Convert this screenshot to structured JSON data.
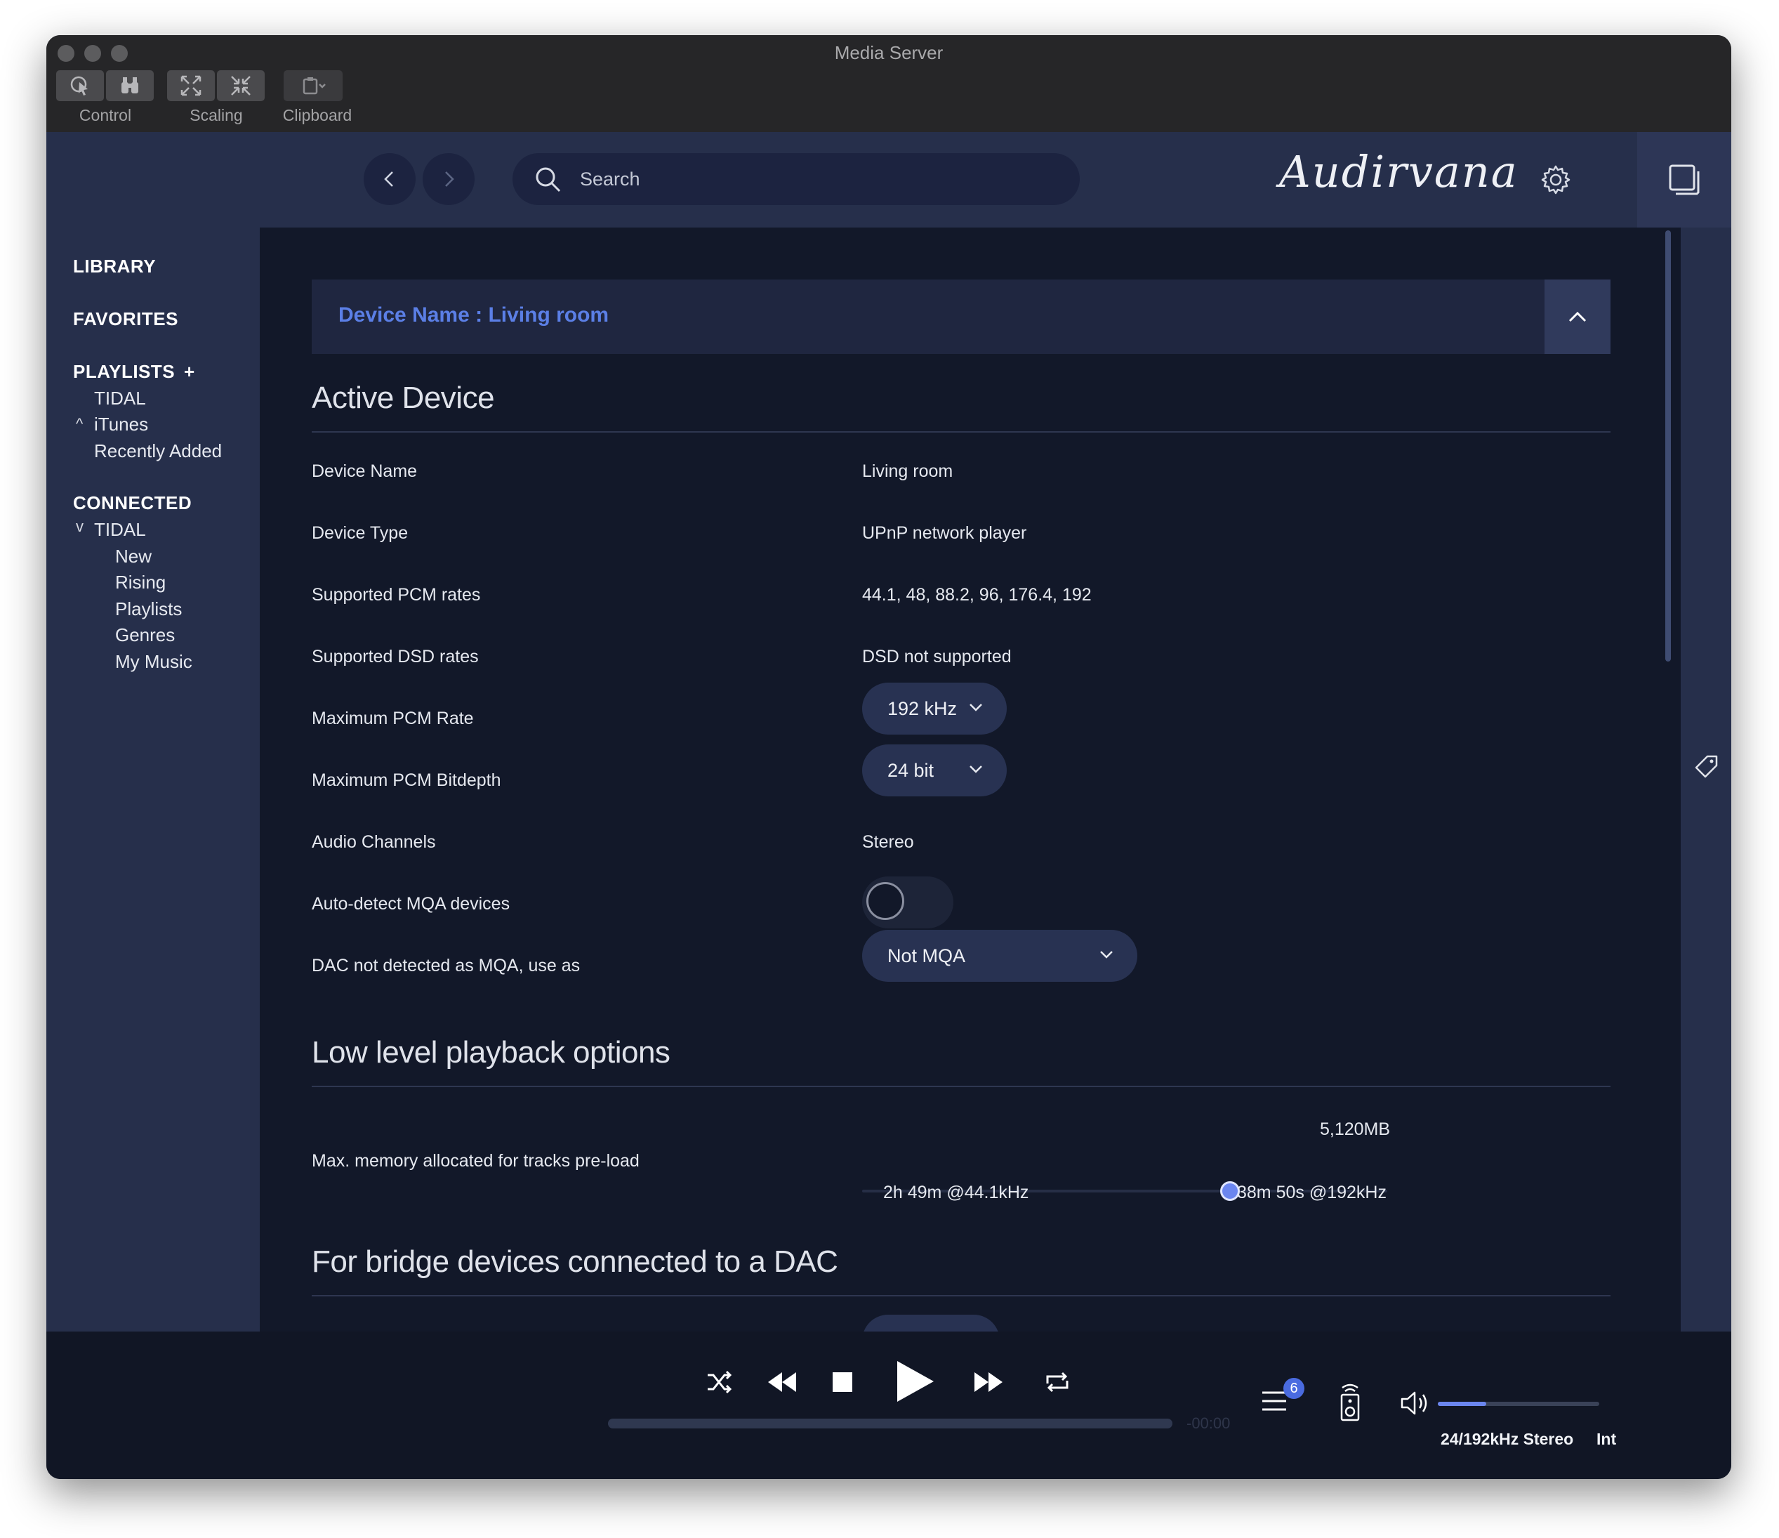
{
  "window": {
    "title": "Media Server"
  },
  "toolbar": {
    "groups": [
      {
        "label": "Control"
      },
      {
        "label": "Scaling"
      },
      {
        "label": "Clipboard"
      }
    ]
  },
  "header": {
    "search_placeholder": "Search",
    "logo": "Audirvana"
  },
  "sidebar": {
    "library": "LIBRARY",
    "favorites": "FAVORITES",
    "playlists": "PLAYLISTS",
    "playlists_add": "+",
    "playlist_items": [
      "TIDAL",
      "iTunes",
      "Recently Added"
    ],
    "connected": "CONNECTED",
    "connected_service": "TIDAL",
    "connected_items": [
      "New",
      "Rising",
      "Playlists",
      "Genres",
      "My Music"
    ]
  },
  "main": {
    "device_bar_title": "Device Name : Living room",
    "section_active": "Active Device",
    "rows": [
      {
        "label": "Device Name",
        "value": "Living room"
      },
      {
        "label": "Device Type",
        "value": "UPnP network player"
      },
      {
        "label": "Supported PCM rates",
        "value": "44.1, 48, 88.2, 96, 176.4, 192"
      },
      {
        "label": "Supported DSD rates",
        "value": "DSD not supported"
      },
      {
        "label": "Maximum PCM Rate",
        "value": "192 kHz"
      },
      {
        "label": "Maximum PCM Bitdepth",
        "value": "24 bit"
      },
      {
        "label": "Audio Channels",
        "value": "Stereo"
      },
      {
        "label": "Auto-detect MQA devices",
        "value": ""
      },
      {
        "label": "DAC not detected as MQA, use as",
        "value": "Not MQA"
      }
    ],
    "mqa_autodetect_on": false,
    "section_lowlevel": "Low level playback options",
    "preload_label": "Max. memory allocated for tracks pre-load",
    "preload_value": "5,120MB",
    "preload_fraction": 0.7,
    "preload_left": "2h 49m @44.1kHz",
    "preload_right": "38m 50s @192kHz",
    "section_bridge": "For bridge devices connected to a DAC"
  },
  "player": {
    "time": "-00:00",
    "queue_count": "6",
    "volume_fraction": 0.3,
    "format": "24/192kHz Stereo",
    "output": "Int"
  },
  "colors": {
    "background": "#121829",
    "sidebar": "#262f4b",
    "accent": "#5b7fe6"
  }
}
